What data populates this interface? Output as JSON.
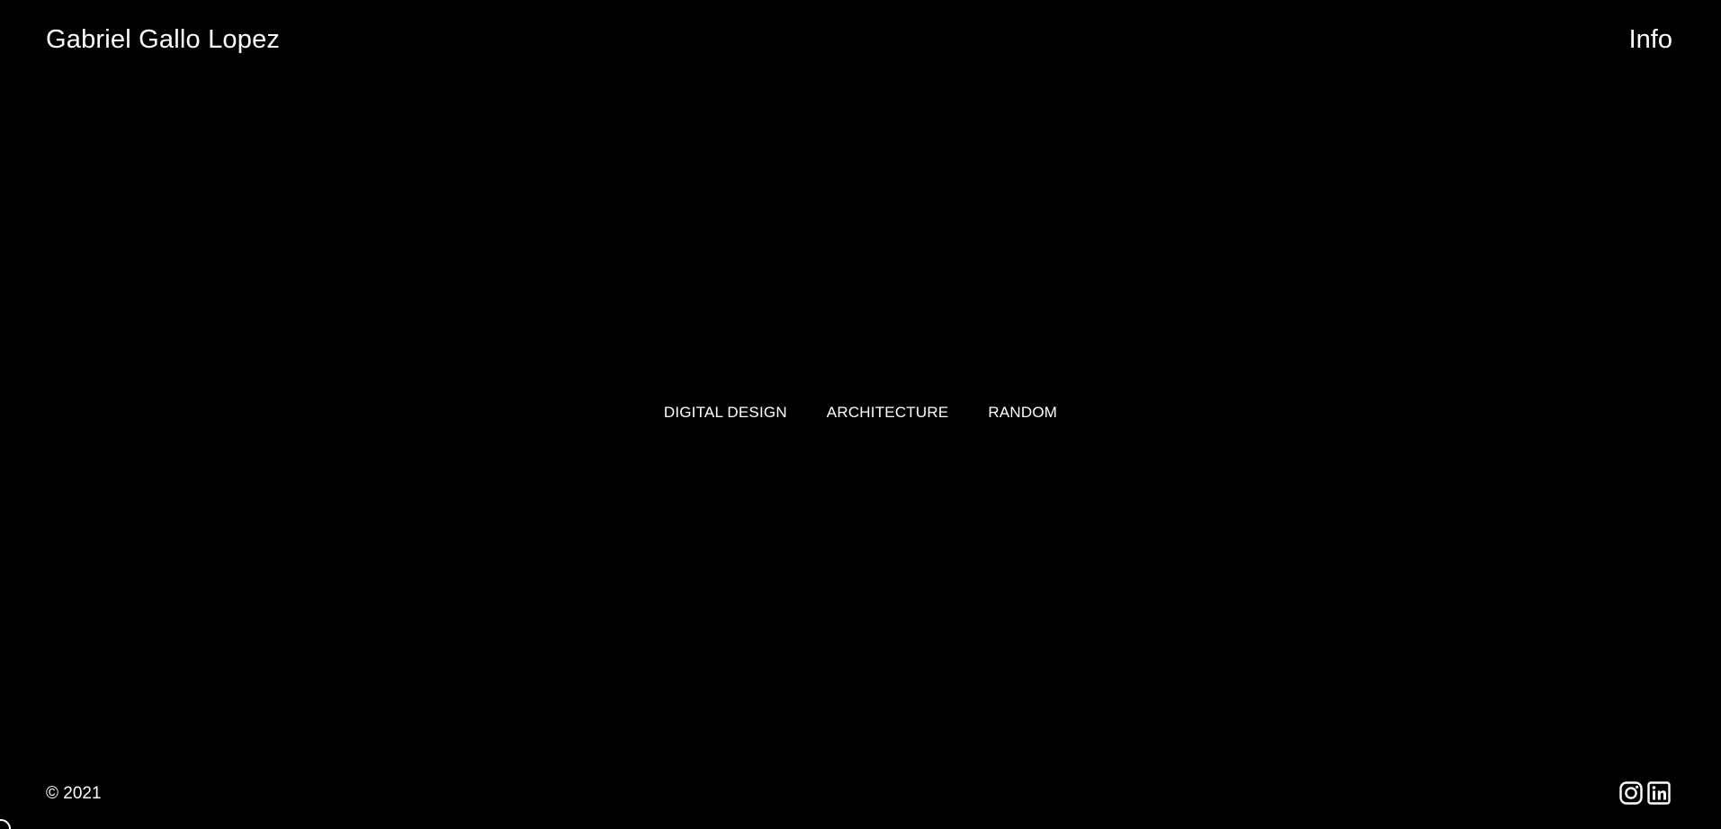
{
  "header": {
    "site_title": "Gabriel Gallo Lopez",
    "info_label": "Info"
  },
  "nav": {
    "items": [
      {
        "label": "DIGITAL DESIGN"
      },
      {
        "label": "ARCHITECTURE"
      },
      {
        "label": "RANDOM"
      }
    ]
  },
  "footer": {
    "copyright": "© 2021",
    "social_icons": [
      "instagram-icon",
      "linkedin-icon"
    ]
  },
  "colors": {
    "background": "#000000",
    "text": "#ffffff"
  }
}
